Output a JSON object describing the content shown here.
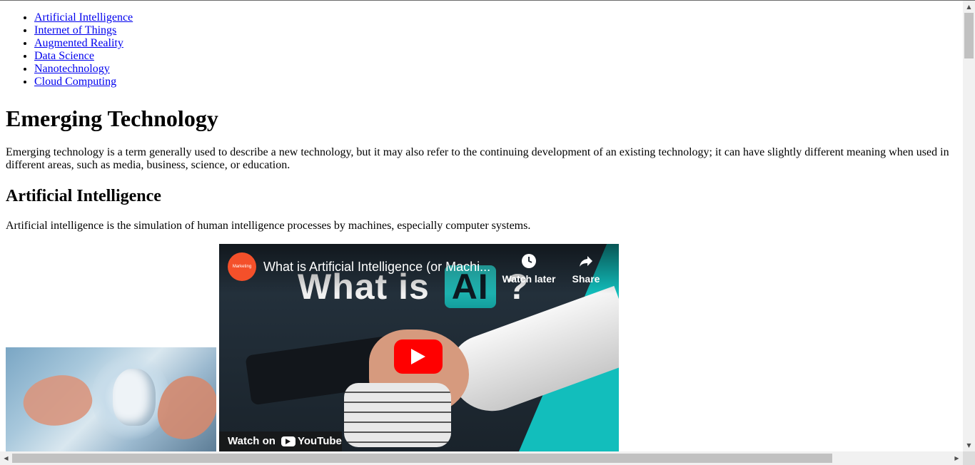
{
  "nav": {
    "items": [
      {
        "label": "Artificial Intelligence"
      },
      {
        "label": "Internet of Things"
      },
      {
        "label": "Augmented Reality"
      },
      {
        "label": "Data Science"
      },
      {
        "label": "Nanotechnology"
      },
      {
        "label": "Cloud Computing"
      }
    ]
  },
  "main": {
    "title": "Emerging Technology",
    "intro": "Emerging technology is a term generally used to describe a new technology, but it may also refer to the continuing development of an existing technology; it can have slightly different meaning when used in different areas, such as media, business, science, or education.",
    "ai_heading": "Artificial Intelligence",
    "ai_description": "Artificial intelligence is the simulation of human intelligence processes by machines, especially computer systems."
  },
  "video": {
    "channel_avatar_text": "Marketing",
    "title": "What is Artificial Intelligence (or Machi...",
    "thumbnail_text_prefix": "What is",
    "thumbnail_text_ai": "AI",
    "thumbnail_text_suffix": "?",
    "watch_later_label": "Watch later",
    "share_label": "Share",
    "watch_on_label": "Watch on",
    "youtube_label": "YouTube",
    "play_color": "#ff0000"
  },
  "icons": {
    "clock": "clock-icon",
    "share": "share-icon",
    "play": "play-icon"
  },
  "colors": {
    "link": "#0000ee",
    "teal": "#13bfbd"
  }
}
